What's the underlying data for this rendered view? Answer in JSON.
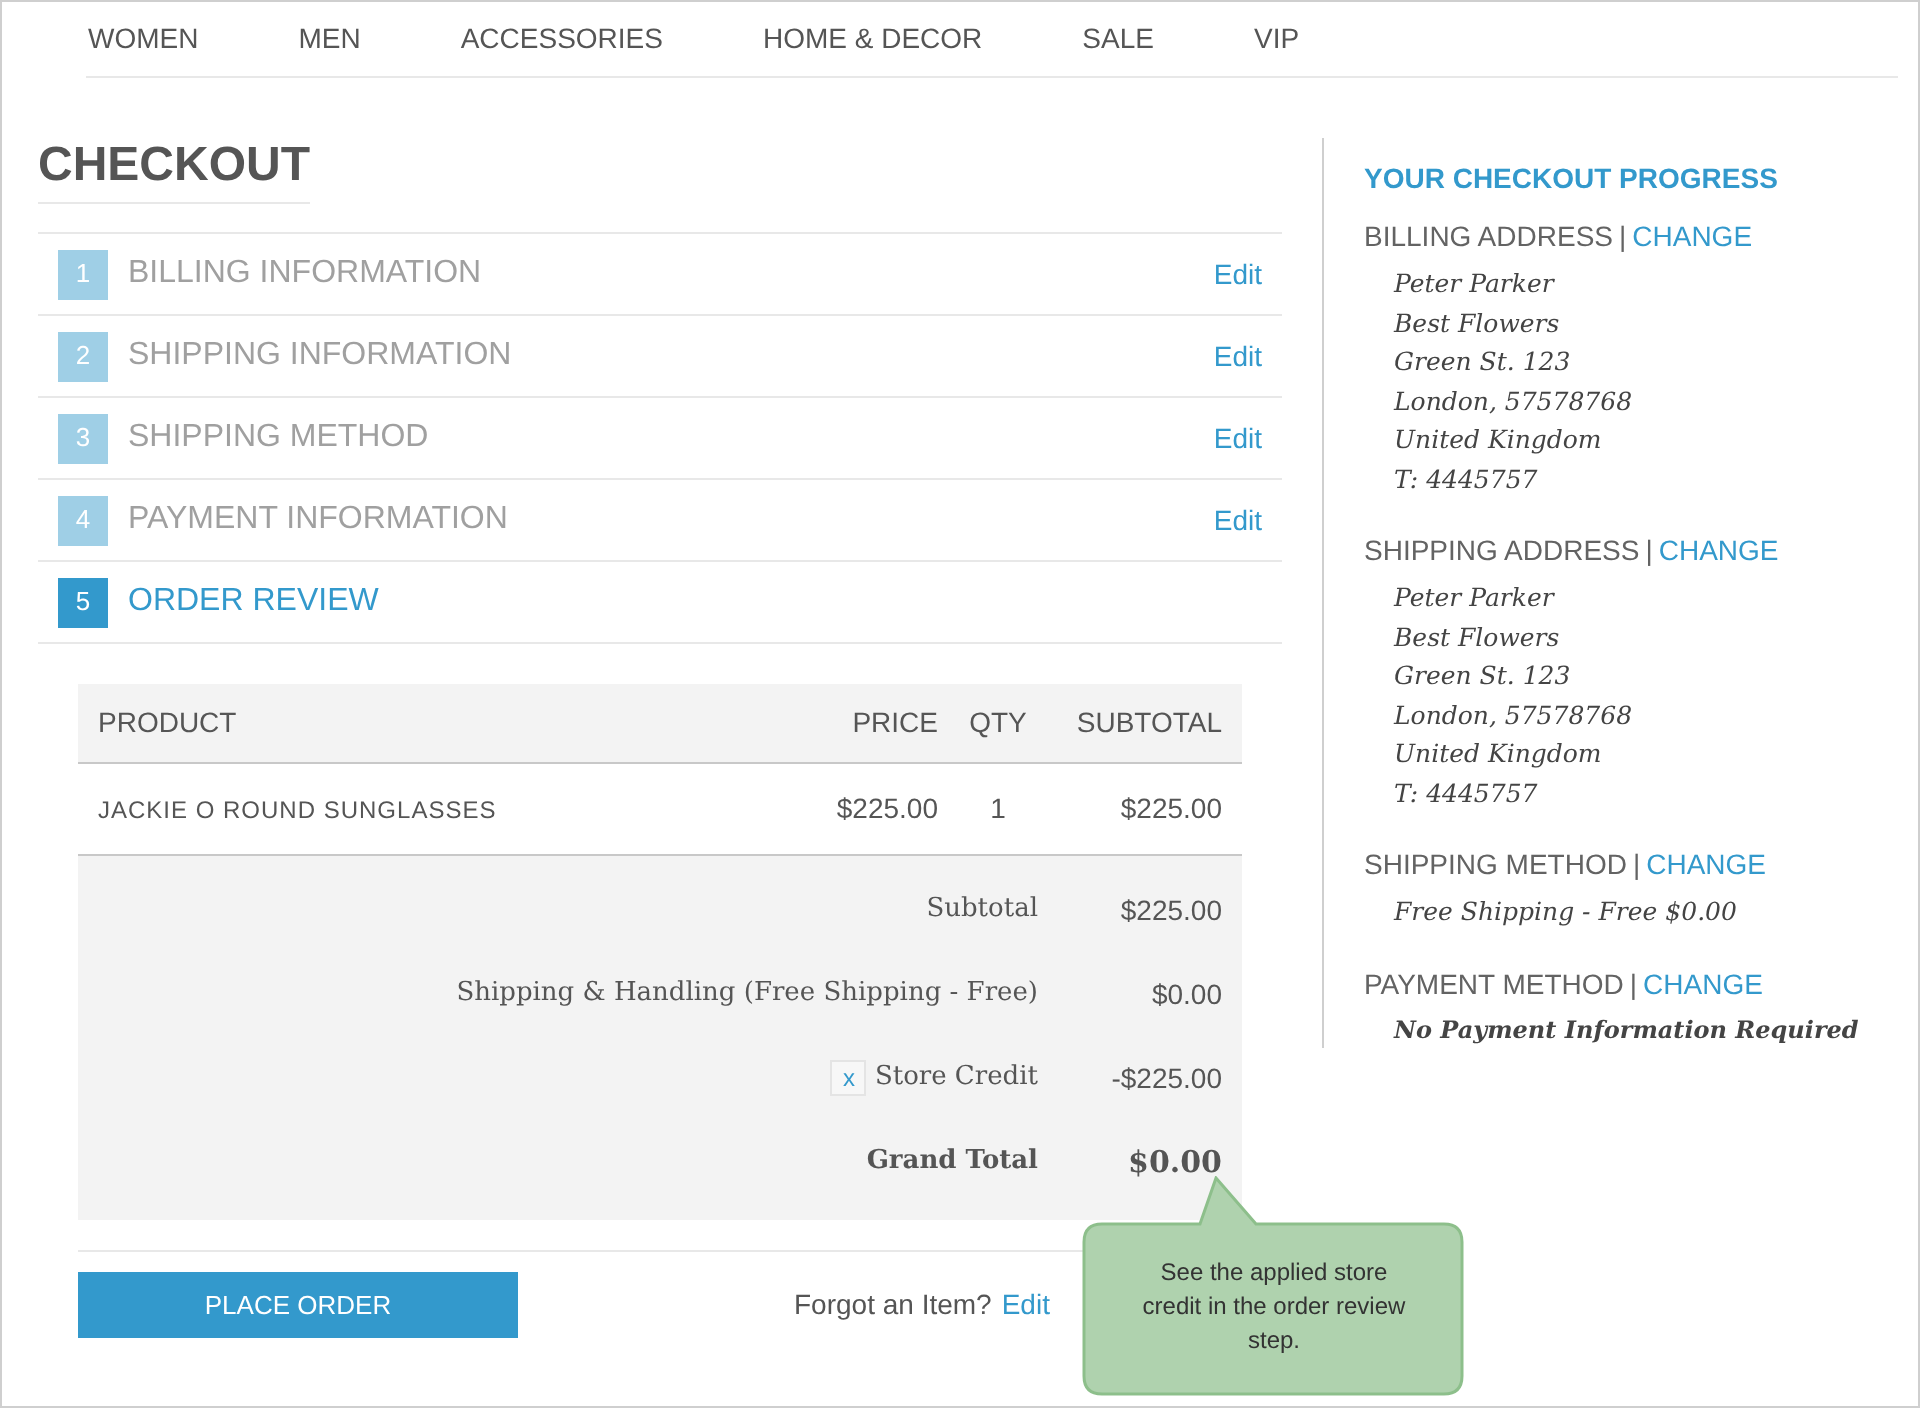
{
  "nav": [
    "WOMEN",
    "MEN",
    "ACCESSORIES",
    "HOME & DECOR",
    "SALE",
    "VIP"
  ],
  "title": "CHECKOUT",
  "steps": [
    {
      "number": "1",
      "label": "BILLING INFORMATION",
      "edit": "Edit",
      "selected": false
    },
    {
      "number": "2",
      "label": "SHIPPING INFORMATION",
      "edit": "Edit",
      "selected": false
    },
    {
      "number": "3",
      "label": "SHIPPING METHOD",
      "edit": "Edit",
      "selected": false
    },
    {
      "number": "4",
      "label": "PAYMENT INFORMATION",
      "edit": "Edit",
      "selected": false
    },
    {
      "number": "5",
      "label": "ORDER REVIEW",
      "selected": true
    }
  ],
  "table": {
    "columns": [
      "PRODUCT",
      "PRICE",
      "QTY",
      "SUBTOTAL"
    ],
    "rows": [
      [
        "JACKIE O ROUND SUNGLASSES",
        "$225.00",
        "1",
        "$225.00"
      ]
    ],
    "totals": [
      {
        "kind": "plain",
        "label": "Subtotal",
        "value": "$225.00"
      },
      {
        "kind": "plain",
        "label": "Shipping & Handling (Free Shipping - Free)",
        "value": "$0.00"
      },
      {
        "kind": "credit",
        "remove": "x",
        "label": "Store Credit",
        "value": "-$225.00"
      },
      {
        "kind": "grand",
        "label": "Grand Total",
        "value": "$0.00"
      }
    ]
  },
  "place_order": "PLACE ORDER",
  "forgot": {
    "text": "Forgot an Item?",
    "link": "Edit"
  },
  "callout": "See the applied store credit in the order review step.",
  "progress": {
    "title": "YOUR CHECKOUT PROGRESS",
    "sections": [
      {
        "kind": "lines",
        "heading": "BILLING ADDRESS",
        "separator": "|",
        "change": "CHANGE",
        "lines": [
          "Peter Parker",
          "Best Flowers",
          "Green St. 123",
          "London, 57578768",
          "United Kingdom",
          "T: 4445757"
        ]
      },
      {
        "kind": "lines",
        "heading": "SHIPPING ADDRESS",
        "separator": "|",
        "change": "CHANGE",
        "lines": [
          "Peter Parker",
          "Best Flowers",
          "Green St. 123",
          "London, 57578768",
          "United Kingdom",
          "T: 4445757"
        ]
      },
      {
        "kind": "lines",
        "heading": "SHIPPING METHOD",
        "separator": "|",
        "change": "CHANGE",
        "lines": [
          "Free Shipping - Free $0.00"
        ]
      },
      {
        "kind": "strong",
        "heading": "PAYMENT METHOD",
        "separator": "|",
        "change": "CHANGE",
        "lines": [
          "No Payment Information Required"
        ]
      }
    ]
  }
}
